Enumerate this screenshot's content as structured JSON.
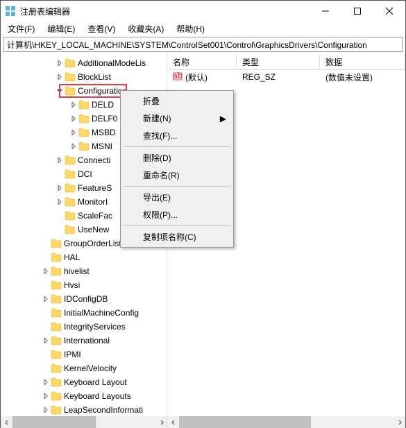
{
  "titlebar": {
    "title": "注册表编辑器"
  },
  "menubar": {
    "file": "文件(F)",
    "edit": "编辑(E)",
    "view": "查看(V)",
    "favorites": "收藏夹(A)",
    "help": "帮助(H)"
  },
  "pathbar": {
    "path": "计算机\\HKEY_LOCAL_MACHINE\\SYSTEM\\ControlSet001\\Control\\GraphicsDrivers\\Configuration"
  },
  "tree": {
    "items": [
      {
        "indent": 78,
        "expander": "right",
        "label": "AdditionalModeLis"
      },
      {
        "indent": 78,
        "expander": "right",
        "label": "BlockList"
      },
      {
        "indent": 78,
        "expander": "down",
        "label": "Configuration",
        "highlight": true
      },
      {
        "indent": 98,
        "expander": "right",
        "label": "DELD"
      },
      {
        "indent": 98,
        "expander": "right",
        "label": "DELF0"
      },
      {
        "indent": 98,
        "expander": "right",
        "label": "MSBD"
      },
      {
        "indent": 98,
        "expander": "right",
        "label": "MSNI"
      },
      {
        "indent": 78,
        "expander": "right",
        "label": "Connecti"
      },
      {
        "indent": 78,
        "expander": "none",
        "label": "DCI"
      },
      {
        "indent": 78,
        "expander": "right",
        "label": "FeatureS"
      },
      {
        "indent": 78,
        "expander": "right",
        "label": "MonitorI"
      },
      {
        "indent": 78,
        "expander": "none",
        "label": "ScaleFac"
      },
      {
        "indent": 78,
        "expander": "none",
        "label": "UseNew"
      },
      {
        "indent": 58,
        "expander": "none",
        "label": "GroupOrderList"
      },
      {
        "indent": 58,
        "expander": "none",
        "label": "HAL"
      },
      {
        "indent": 58,
        "expander": "right",
        "label": "hivelist"
      },
      {
        "indent": 58,
        "expander": "none",
        "label": "Hvsi"
      },
      {
        "indent": 58,
        "expander": "right",
        "label": "IDConfigDB"
      },
      {
        "indent": 58,
        "expander": "none",
        "label": "InitialMachineConfig"
      },
      {
        "indent": 58,
        "expander": "none",
        "label": "IntegrityServices"
      },
      {
        "indent": 58,
        "expander": "right",
        "label": "International"
      },
      {
        "indent": 58,
        "expander": "none",
        "label": "IPMI"
      },
      {
        "indent": 58,
        "expander": "none",
        "label": "KernelVelocity"
      },
      {
        "indent": 58,
        "expander": "right",
        "label": "Keyboard Layout"
      },
      {
        "indent": 58,
        "expander": "right",
        "label": "Keyboard Layouts"
      },
      {
        "indent": 58,
        "expander": "right",
        "label": "LeapSecondInformati"
      }
    ]
  },
  "list": {
    "headers": {
      "name": "名称",
      "type": "类型",
      "data": "数据"
    },
    "row": {
      "name": "(默认)",
      "type": "REG_SZ",
      "data": "(数值未设置)"
    }
  },
  "context": {
    "collapse": "折叠",
    "new": "新建(N)",
    "find": "查找(F)...",
    "delete": "删除(D)",
    "rename": "重命名(R)",
    "export": "导出(E)",
    "permissions": "权限(P)...",
    "copykeyname": "复制项名称(C)"
  }
}
